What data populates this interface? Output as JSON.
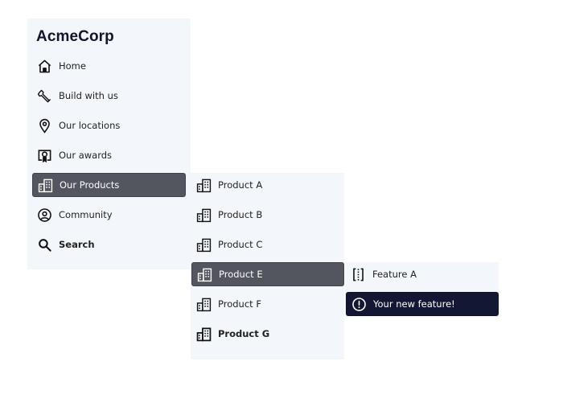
{
  "sidebar": {
    "brand": "AcmeCorp",
    "items": [
      {
        "label": "Home",
        "icon": "home-icon"
      },
      {
        "label": "Build with us",
        "icon": "wrench-icon"
      },
      {
        "label": "Our locations",
        "icon": "map-pin-icon"
      },
      {
        "label": "Our awards",
        "icon": "award-certificate-icon"
      },
      {
        "label": "Our Products",
        "icon": "building-icon",
        "active": true
      },
      {
        "label": "Community",
        "icon": "user-circle-icon"
      },
      {
        "label": "Search",
        "icon": "search-icon"
      }
    ]
  },
  "products_menu": {
    "items": [
      {
        "label": "Product A",
        "icon": "building-icon"
      },
      {
        "label": "Product B",
        "icon": "building-icon"
      },
      {
        "label": "Product C",
        "icon": "building-icon"
      },
      {
        "label": "Product E",
        "icon": "building-icon",
        "active": true
      },
      {
        "label": "Product F",
        "icon": "building-icon"
      },
      {
        "label": "Product G",
        "icon": "building-icon"
      }
    ]
  },
  "features_menu": {
    "items": [
      {
        "label": "Feature A",
        "icon": "bracket-dotted-icon"
      },
      {
        "label": "Your new feature!",
        "icon": "alert-circle-icon",
        "highlight": true
      }
    ]
  },
  "colors": {
    "panel_bg": "#f3f6fb",
    "active_bg": "#53555f",
    "alert_bg": "#141733",
    "text": "#222222"
  }
}
